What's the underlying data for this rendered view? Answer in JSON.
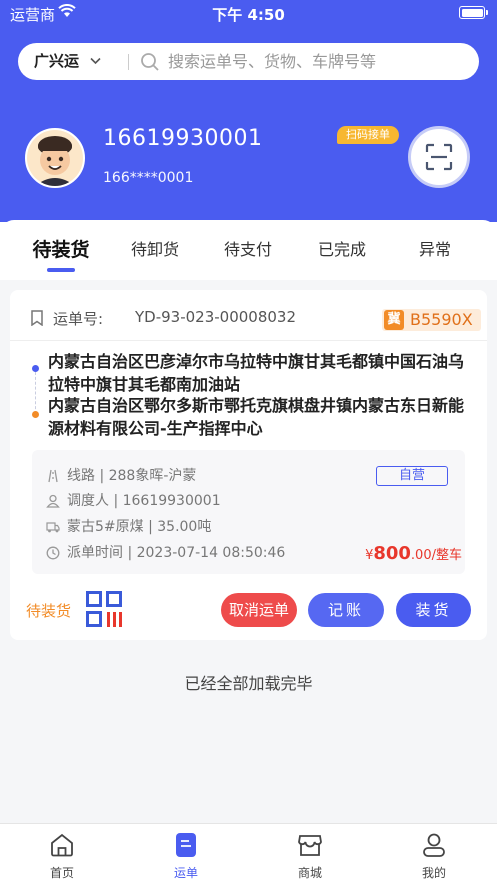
{
  "status_bar": {
    "carrier": "运营商",
    "time": "下午 4:50"
  },
  "search": {
    "city": "广兴运",
    "placeholder": "搜索运单号、货物、车牌号等"
  },
  "profile": {
    "phone": "16619930001",
    "masked_phone": "166****0001",
    "scan_badge": "扫码接单"
  },
  "tabs": [
    {
      "label": "待装货",
      "active": true
    },
    {
      "label": "待卸货"
    },
    {
      "label": "待支付"
    },
    {
      "label": "已完成"
    },
    {
      "label": "异常"
    }
  ],
  "order": {
    "waybill_label": "运单号:",
    "waybill_number": "YD-93-023-00008032",
    "plate_prefix": "冀",
    "plate_number": "B5590X",
    "origin": "内蒙古自治区巴彦淖尔市乌拉特中旗甘其毛都镇中国石油乌拉特中旗甘其毛都南加油站",
    "destination": "内蒙古自治区鄂尔多斯市鄂托克旗棋盘井镇内蒙古东日新能源材料有限公司-生产指挥中心",
    "route": "线路 | 288象晖-沪蒙",
    "tag": "自营",
    "dispatcher": "调度人 | 16619930001",
    "cargo": "蒙古5#原煤 | 35.00吨",
    "dispatch_time": "派单时间 | 2023-07-14 08:50:46",
    "price_currency": "¥",
    "price_main": "800",
    "price_decimal": ".00",
    "price_unit": "/整车",
    "status": "待装货",
    "buttons": {
      "cancel": "取消运单",
      "account": "记账",
      "load": "装货"
    }
  },
  "list_end": "已经全部加载完毕",
  "nav": [
    {
      "label": "首页",
      "icon": "home-icon"
    },
    {
      "label": "运单",
      "icon": "waybill-icon",
      "active": true
    },
    {
      "label": "商城",
      "icon": "store-icon"
    },
    {
      "label": "我的",
      "icon": "profile-icon"
    }
  ],
  "colors": {
    "primary": "#4a5cf0",
    "accent": "#f28c28",
    "danger": "#ee4b4b",
    "price": "#e8372c"
  }
}
